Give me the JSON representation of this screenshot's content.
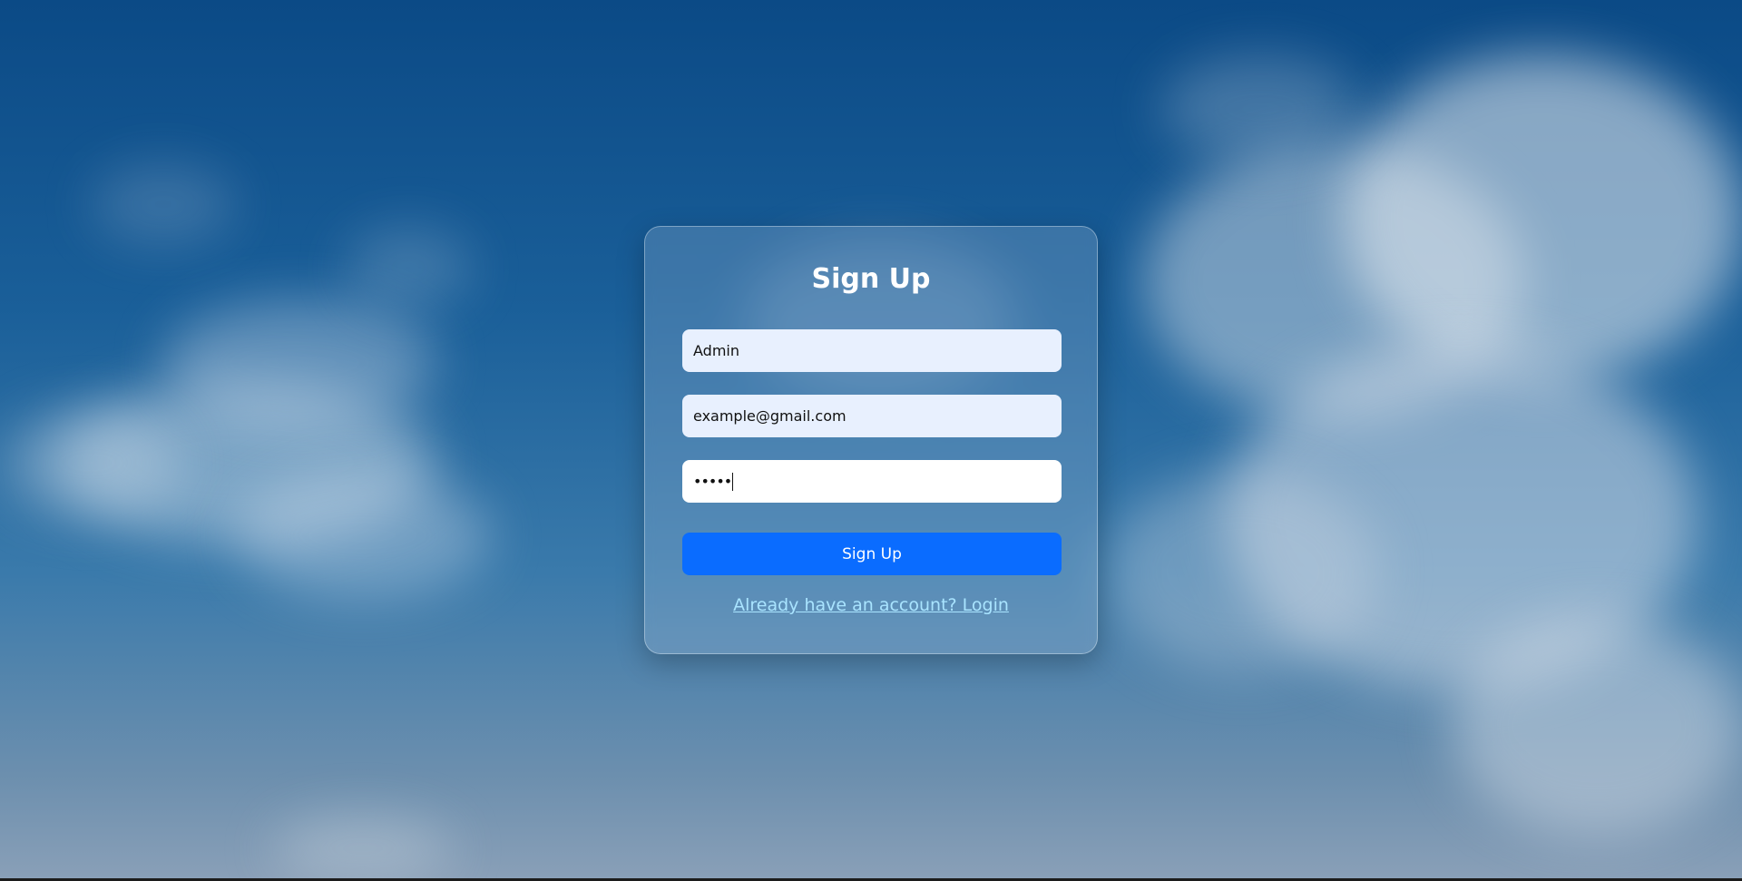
{
  "form": {
    "title": "Sign Up",
    "name_value": "Admin",
    "email_value": "example@gmail.com",
    "password_masked": "•••••",
    "submit_label": "Sign Up",
    "login_link": "Already have an account? Login"
  },
  "colors": {
    "button": "#0a6cff",
    "link": "#a9e4ff",
    "autofill_field": "#e8f0fe"
  }
}
